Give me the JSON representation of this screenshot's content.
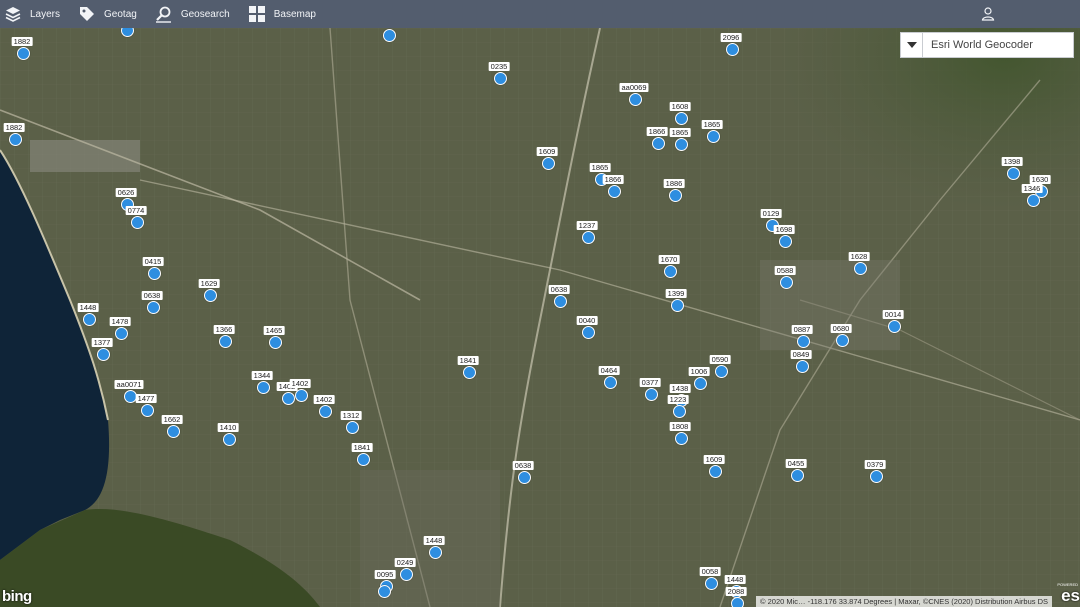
{
  "toolbar": {
    "layers_label": "Layers",
    "geotag_label": "Geotag",
    "geosearch_label": "Geosearch",
    "basemap_label": "Basemap"
  },
  "geocoder": {
    "selected": "Esri World Geocoder"
  },
  "attribution": {
    "bing": "bing",
    "text": "© 2020 Mic… -118.176 33.874 Degrees | Maxar, ©CNES (2020) Distribution Airbus DS",
    "esri": "es",
    "powered": "POWERED"
  },
  "colors": {
    "toolbar": "#535d6e",
    "marker": "#2e8ee0",
    "ocean": "#0f2438"
  },
  "markers": [
    {
      "label": "1882"
    },
    {
      "label": ""
    },
    {
      "label": ""
    },
    {
      "label": "2096"
    },
    {
      "label": "0235"
    },
    {
      "label": "aa0069"
    },
    {
      "label": "1608"
    },
    {
      "label": "1882"
    },
    {
      "label": "1866"
    },
    {
      "label": "1865"
    },
    {
      "label": "1865"
    },
    {
      "label": "1609"
    },
    {
      "label": "1865"
    },
    {
      "label": "1866"
    },
    {
      "label": "1886"
    },
    {
      "label": "1398"
    },
    {
      "label": "1630"
    },
    {
      "label": "1346"
    },
    {
      "label": "0626"
    },
    {
      "label": "0774"
    },
    {
      "label": "0129"
    },
    {
      "label": "1698"
    },
    {
      "label": "1237"
    },
    {
      "label": "1670"
    },
    {
      "label": "1628"
    },
    {
      "label": "0415"
    },
    {
      "label": "0588"
    },
    {
      "label": "1629"
    },
    {
      "label": "0638"
    },
    {
      "label": "0638"
    },
    {
      "label": "1399"
    },
    {
      "label": "1448"
    },
    {
      "label": "1478"
    },
    {
      "label": "0014"
    },
    {
      "label": "0040"
    },
    {
      "label": "1366"
    },
    {
      "label": "1465"
    },
    {
      "label": "0887"
    },
    {
      "label": "0680"
    },
    {
      "label": "1377"
    },
    {
      "label": "0849"
    },
    {
      "label": "1841"
    },
    {
      "label": "0590"
    },
    {
      "label": "1006"
    },
    {
      "label": "0464"
    },
    {
      "label": "0377"
    },
    {
      "label": "1344"
    },
    {
      "label": "aa0071"
    },
    {
      "label": "1402"
    },
    {
      "label": "1402"
    },
    {
      "label": "1438"
    },
    {
      "label": "1477"
    },
    {
      "label": "1402"
    },
    {
      "label": "1223"
    },
    {
      "label": "1662"
    },
    {
      "label": "1312"
    },
    {
      "label": "1410"
    },
    {
      "label": "1808"
    },
    {
      "label": "1841"
    },
    {
      "label": "1609"
    },
    {
      "label": "0638"
    },
    {
      "label": "0455"
    },
    {
      "label": "0379"
    },
    {
      "label": "1448"
    },
    {
      "label": "0249"
    },
    {
      "label": "0095"
    },
    {
      "label": "0058"
    },
    {
      "label": "1448"
    },
    {
      "label": "2088"
    },
    {
      "label": ""
    }
  ]
}
